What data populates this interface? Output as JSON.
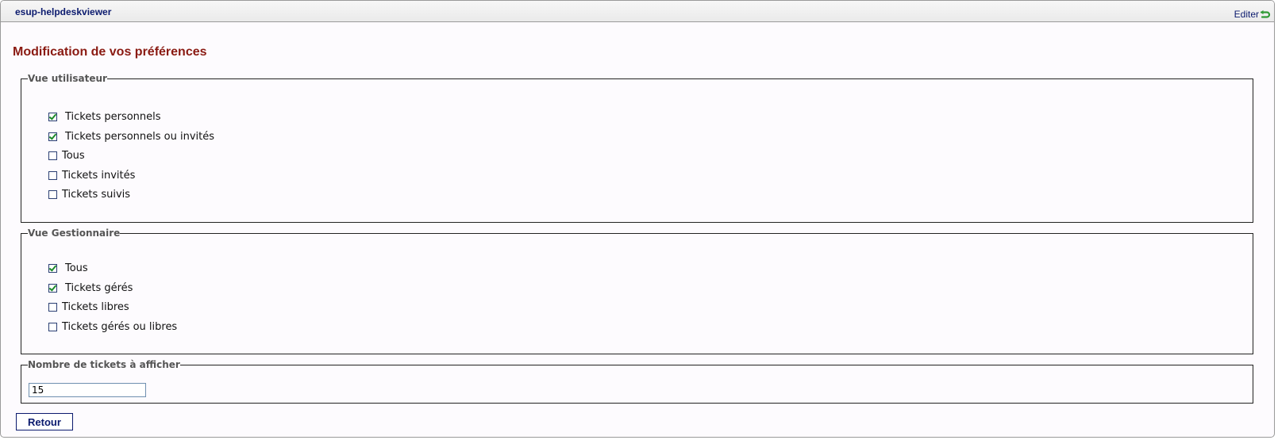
{
  "portlet": {
    "title": "esup-helpdeskviewer",
    "edit_label": "Editer",
    "edit_icon": "edit-arrow-icon"
  },
  "page": {
    "title": "Modification de vos préférences"
  },
  "user_view": {
    "legend": "Vue utilisateur",
    "options": [
      {
        "label": "Tickets personnels",
        "checked": true
      },
      {
        "label": "Tickets personnels ou invités",
        "checked": true
      },
      {
        "label": "Tous",
        "checked": false
      },
      {
        "label": "Tickets invités",
        "checked": false
      },
      {
        "label": "Tickets suivis",
        "checked": false
      }
    ]
  },
  "manager_view": {
    "legend": "Vue Gestionnaire",
    "options": [
      {
        "label": "Tous",
        "checked": true
      },
      {
        "label": "Tickets gérés",
        "checked": true
      },
      {
        "label": "Tickets libres",
        "checked": false
      },
      {
        "label": "Tickets gérés ou libres",
        "checked": false
      }
    ]
  },
  "ticket_count": {
    "legend": "Nombre de tickets à afficher",
    "value": "15"
  },
  "actions": {
    "back_label": "Retour"
  },
  "colors": {
    "title_red": "#8a1a12",
    "link_blue": "#0b1a6e",
    "check_green": "#1c8a2a"
  }
}
